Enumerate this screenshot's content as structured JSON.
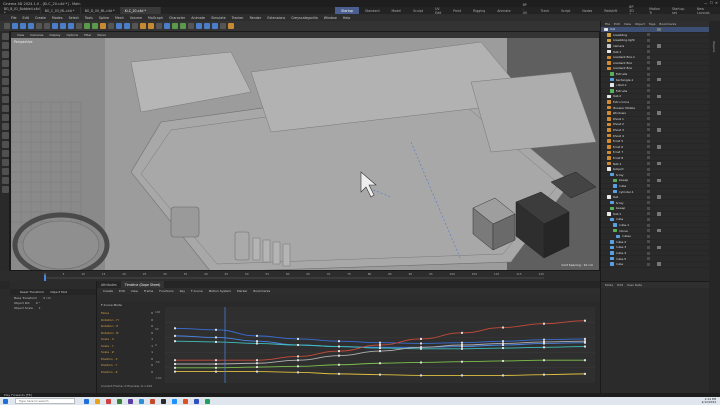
{
  "window": {
    "title": "Cinema 4D 2024.1.0 - [Ki.C_20.c4d *] - Main",
    "tabs": [
      "BG_B_01_Bubble4.c4d *",
      "BG_C_03_ML.c4d *",
      "BG_D_00_ML.c4d *",
      "Ki.C_20.c4d *"
    ],
    "active_tab_index": 3,
    "layouts": [
      "Startup",
      "Standard",
      "Model",
      "Sculpt",
      "UV Edit",
      "Paint",
      "Rigging",
      "Animate",
      "BP - UV Edit",
      "Track",
      "Script",
      "Nodes",
      "Redshift",
      "BP 3D Paint",
      "Motion Tr",
      "Startup-set"
    ],
    "active_layout_index": 0,
    "new_layouts_label": "New Layouts"
  },
  "menubar": [
    "File",
    "Edit",
    "Create",
    "Modes",
    "Select",
    "Tools",
    "Spline",
    "Mesh",
    "Volume",
    "MoGraph",
    "Character",
    "Animate",
    "Simulate",
    "Tracker",
    "Render",
    "Extensions",
    "Greyscalegorilla",
    "Window",
    "Help"
  ],
  "viewport": {
    "menu": [
      "View",
      "Cameras",
      "Display",
      "Options",
      "Filter",
      "Panel"
    ],
    "label": "Perspective",
    "grid_spacing": "Grid Spacing : 10 cm"
  },
  "timeline": {
    "ticks": [
      "0",
      "5",
      "10",
      "15",
      "20",
      "25",
      "30",
      "35",
      "40",
      "45",
      "50",
      "55",
      "60",
      "65",
      "70",
      "75",
      "80",
      "85",
      "90",
      "95",
      "100",
      "105",
      "110",
      "115",
      "120"
    ],
    "current_frame": "0 F",
    "start_frame": "0 F",
    "end_frame": "120 F",
    "min_frame": "120 F",
    "tooltip_title": "Go to Next Frame",
    "tooltip_line1": "Step to Next Frame",
    "tooltip_line2": "[F]"
  },
  "left_tracks": {
    "header_a": "Reset Transform",
    "header_b": "Object Mod",
    "rows": [
      {
        "name": "Base Transform",
        "value": "0 cm"
      },
      {
        "name": "Object Rot",
        "value": "0 °"
      },
      {
        "name": "Object Scale",
        "value": "1"
      }
    ]
  },
  "graph": {
    "tabs": [
      "Attributes",
      "Timeline (Dope Sheet)"
    ],
    "active_tab_index": 1,
    "menu": [
      "Create",
      "Edit",
      "View",
      "Frame",
      "Functions",
      "Key",
      "F-Curve",
      "Motion System",
      "Marker",
      "Bookmarks"
    ],
    "mode_label": "F-Curve Mode",
    "tracks": [
      "Move",
      "Rotation . H",
      "Rotation . P",
      "Rotation . B",
      "Scale . X",
      "Scale . Y",
      "Scale . Z",
      "Position . X",
      "Position . Y",
      "Position . Z"
    ],
    "track_values": [
      "0",
      "0",
      "0",
      "0",
      "1",
      "1",
      "1",
      "0",
      "0",
      "0"
    ],
    "y_labels": [
      "100",
      "50",
      "0",
      "-50",
      "-100"
    ],
    "footer": "Current Frame: 0  Preview: 0->120",
    "curves": [
      {
        "color": "#3a6fd6",
        "values": [
          0.72,
          0.7,
          0.62,
          0.58,
          0.55,
          0.53,
          0.52,
          0.53,
          0.55,
          0.57,
          0.58
        ]
      },
      {
        "color": "#4a86e8",
        "values": [
          0.62,
          0.6,
          0.55,
          0.5,
          0.48,
          0.47,
          0.47,
          0.48,
          0.5,
          0.52,
          0.53
        ]
      },
      {
        "color": "#3fbfbf",
        "values": [
          0.55,
          0.54,
          0.52,
          0.5,
          0.48,
          0.46,
          0.45,
          0.45,
          0.46,
          0.47,
          0.48
        ]
      },
      {
        "color": "#c84b3a",
        "values": [
          0.3,
          0.3,
          0.3,
          0.35,
          0.42,
          0.5,
          0.58,
          0.66,
          0.73,
          0.78,
          0.82
        ]
      },
      {
        "color": "#b0b0b0",
        "values": [
          0.25,
          0.25,
          0.26,
          0.3,
          0.36,
          0.42,
          0.47,
          0.5,
          0.52,
          0.54,
          0.55
        ]
      },
      {
        "color": "#7dc24a",
        "values": [
          0.2,
          0.2,
          0.21,
          0.22,
          0.24,
          0.26,
          0.27,
          0.28,
          0.29,
          0.3,
          0.3
        ]
      },
      {
        "color": "#e0c040",
        "values": [
          0.15,
          0.15,
          0.15,
          0.14,
          0.12,
          0.11,
          0.1,
          0.1,
          0.1,
          0.11,
          0.12
        ]
      }
    ]
  },
  "objects": {
    "menu": [
      "File",
      "Edit",
      "View",
      "Object",
      "Tags",
      "Bookmarks"
    ],
    "items": [
      {
        "name": "Null",
        "color": "#e8e8e8",
        "depth": 0
      },
      {
        "name": "Greebling",
        "color": "#d0a040",
        "depth": 1
      },
      {
        "name": "Greebling.light",
        "color": "#d0a040",
        "depth": 1
      },
      {
        "name": "Camera",
        "color": "#c8c8c8",
        "depth": 1
      },
      {
        "name": "Null.1",
        "color": "#e8e8e8",
        "depth": 1
      },
      {
        "name": "Gradient Box.1",
        "color": "#d08a30",
        "depth": 1
      },
      {
        "name": "Gradient Box",
        "color": "#d08a30",
        "depth": 1
      },
      {
        "name": "Gradient Box",
        "color": "#d08a30",
        "depth": 1
      },
      {
        "name": "Extrude",
        "color": "#5ab05a",
        "depth": 2
      },
      {
        "name": "Rectangle.1",
        "color": "#5aa0e0",
        "depth": 2
      },
      {
        "name": "L.Null.1",
        "color": "#e8e8e8",
        "depth": 2
      },
      {
        "name": "Extrude",
        "color": "#5ab05a",
        "depth": 2
      },
      {
        "name": "Null.2",
        "color": "#e8e8e8",
        "depth": 1
      },
      {
        "name": "Extru Cone",
        "color": "#d08a30",
        "depth": 1
      },
      {
        "name": "Moosler Mobile",
        "color": "#d08a30",
        "depth": 1
      },
      {
        "name": "Windows",
        "color": "#d08a30",
        "depth": 1
      },
      {
        "name": "Rhost 1",
        "color": "#d08a30",
        "depth": 1
      },
      {
        "name": "Rhost 2",
        "color": "#d08a30",
        "depth": 1
      },
      {
        "name": "Rhost 3",
        "color": "#d08a30",
        "depth": 1
      },
      {
        "name": "Rhost 4",
        "color": "#d08a30",
        "depth": 1
      },
      {
        "name": "Ecret 5",
        "color": "#d08a30",
        "depth": 1
      },
      {
        "name": "Ecret 6",
        "color": "#d08a30",
        "depth": 1
      },
      {
        "name": "Ecret 7",
        "color": "#d08a30",
        "depth": 1
      },
      {
        "name": "Ecret 8",
        "color": "#d08a30",
        "depth": 1
      },
      {
        "name": "Text.1",
        "color": "#d08a30",
        "depth": 1
      },
      {
        "name": "Subject",
        "color": "#e8e8e8",
        "depth": 1
      },
      {
        "name": "Array",
        "color": "#5aa0e0",
        "depth": 2
      },
      {
        "name": "Sweep",
        "color": "#5ab05a",
        "depth": 3
      },
      {
        "name": "Cube",
        "color": "#5aa0e0",
        "depth": 3
      },
      {
        "name": "Cylinder.1",
        "color": "#5aa0e0",
        "depth": 3
      },
      {
        "name": "Null",
        "color": "#e8e8e8",
        "depth": 1
      },
      {
        "name": "Array",
        "color": "#5aa0e0",
        "depth": 2
      },
      {
        "name": "Sweep",
        "color": "#5ab05a",
        "depth": 2
      },
      {
        "name": "Null.1",
        "color": "#e8e8e8",
        "depth": 1
      },
      {
        "name": "Cube",
        "color": "#5aa0e0",
        "depth": 2
      },
      {
        "name": "Cube.1",
        "color": "#5aa0e0",
        "depth": 3
      },
      {
        "name": "Cloner",
        "color": "#5ab05a",
        "depth": 3
      },
      {
        "name": "Cubes",
        "color": "#5aa0e0",
        "depth": 4
      },
      {
        "name": "Cube.2",
        "color": "#5aa0e0",
        "depth": 2
      },
      {
        "name": "Cube.3",
        "color": "#5aa0e0",
        "depth": 2
      },
      {
        "name": "Cube.4",
        "color": "#5aa0e0",
        "depth": 2
      },
      {
        "name": "Cube.5",
        "color": "#5aa0e0",
        "depth": 2
      },
      {
        "name": "Cube",
        "color": "#5aa0e0",
        "depth": 2
      }
    ]
  },
  "attributes": {
    "menu": [
      "Mode",
      "Edit",
      "User Data"
    ]
  },
  "status": {
    "text": "Play Forwards [F8]"
  },
  "taskbar": {
    "search_placeholder": "Type here to search",
    "time": "2:14 PM",
    "date": "2/12/2024",
    "icon_colors": [
      "#1e6fd9",
      "#e8a21a",
      "#d04040",
      "#3a7f3a",
      "#5a3fa0",
      "#2d8fd6",
      "#c04a2a",
      "#2a2a2a",
      "#1e90ff",
      "#e05020",
      "#3050c0",
      "#20a060"
    ]
  }
}
